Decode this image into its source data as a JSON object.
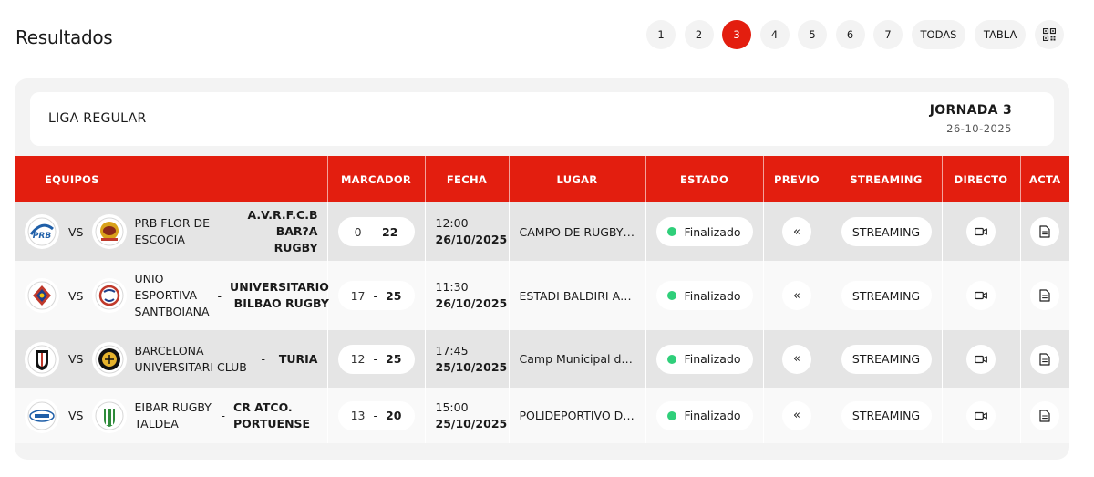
{
  "page": {
    "title": "Resultados"
  },
  "pager": {
    "pages": [
      "1",
      "2",
      "3",
      "4",
      "5",
      "6",
      "7"
    ],
    "active": "3",
    "todas": "TODAS",
    "tabla": "TABLA",
    "qr_icon": "qr-code-icon"
  },
  "league": {
    "name": "LIGA REGULAR",
    "jornada": "JORNADA 3",
    "date": "26-10-2025"
  },
  "table": {
    "headers": {
      "equipos": "EQUIPOS",
      "marcador": "MARCADOR",
      "fecha": "FECHA",
      "lugar": "LUGAR",
      "estado": "ESTADO",
      "previo": "PREVIO",
      "streaming": "STREAMING",
      "directo": "DIRECTO",
      "acta": "ACTA"
    },
    "rows": [
      {
        "vs": "VS",
        "home": "PRB FLOR DE ESCOCIA",
        "dash": "-",
        "away": "A.V.R.F.C.B BAR?A RUGBY",
        "home_score": "0",
        "score_sep": "-",
        "away_score": "22",
        "time": "12:00",
        "date": "26/10/2025",
        "place": "CAMPO DE RUGBY B...",
        "status": "Finalizado",
        "streaming": "STREAMING"
      },
      {
        "vs": "VS",
        "home": "UNIO ESPORTIVA SANTBOIANA",
        "dash": "-",
        "away": "UNIVERSITARIO BILBAO RUGBY",
        "home_score": "17",
        "score_sep": "-",
        "away_score": "25",
        "time": "11:30",
        "date": "26/10/2025",
        "place": "ESTADI BALDIRI ALEU",
        "status": "Finalizado",
        "streaming": "STREAMING"
      },
      {
        "vs": "VS",
        "home": "BARCELONA UNIVERSITARI CLUB",
        "dash": "-",
        "away": "TURIA",
        "home_score": "12",
        "score_sep": "-",
        "away_score": "25",
        "time": "17:45",
        "date": "25/10/2025",
        "place": "Camp Municipal de ...",
        "status": "Finalizado",
        "streaming": "STREAMING"
      },
      {
        "vs": "VS",
        "home": "EIBAR RUGBY TALDEA",
        "dash": "-",
        "away": "CR ATCO. PORTUENSE",
        "home_score": "13",
        "score_sep": "-",
        "away_score": "20",
        "time": "15:00",
        "date": "25/10/2025",
        "place": "POLIDEPORTIVO DE ...",
        "status": "Finalizado",
        "streaming": "STREAMING"
      }
    ]
  },
  "icons": {
    "previo": "double-chevron-left-icon",
    "directo": "video-camera-icon",
    "acta": "document-icon"
  },
  "colors": {
    "accent": "#e31e0f",
    "status_ok": "#2fcf7a"
  }
}
